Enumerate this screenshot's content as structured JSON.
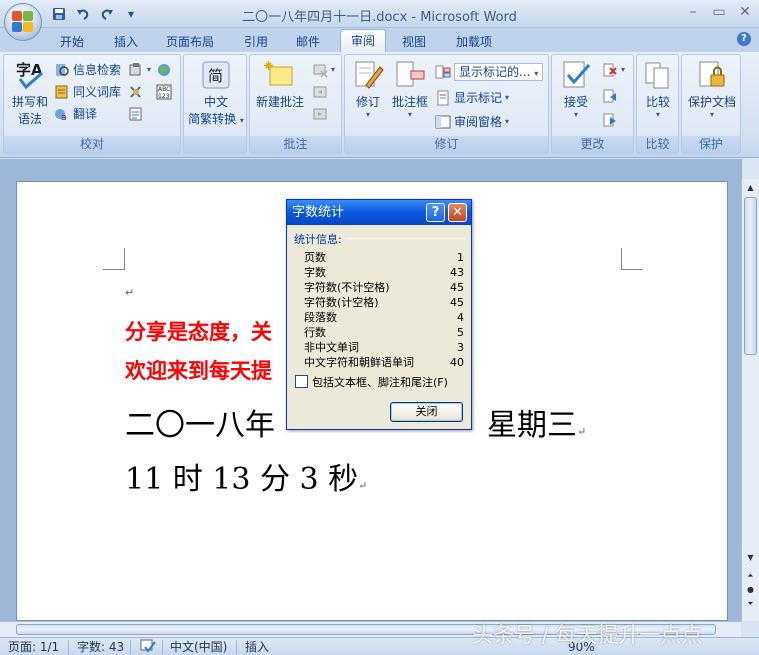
{
  "window": {
    "title": "二〇一八年四月十一日.docx - Microsoft Word",
    "minimize": "–",
    "restore": "▭",
    "close": "✕"
  },
  "qat": {
    "save_icon": "save-icon",
    "undo_icon": "undo-icon",
    "redo_icon": "redo-icon",
    "customize": "▾"
  },
  "tabs": [
    "开始",
    "插入",
    "页面布局",
    "引用",
    "邮件",
    "审阅",
    "视图",
    "加载项"
  ],
  "active_tab": "审阅",
  "help": "?",
  "ribbon": {
    "proofing": {
      "label": "校对",
      "spelling": [
        "拼写和",
        "语法"
      ],
      "research": "信息检索",
      "thesaurus": "同义词库",
      "translate": "翻译"
    },
    "chinese": {
      "icon_char": "简",
      "label_line1": "中文",
      "label_line2": "简繁转换"
    },
    "comments": {
      "label": "批注",
      "new_comment": "新建批注"
    },
    "tracking": {
      "label": "修订",
      "track_changes": "修订",
      "balloons": "批注框",
      "display_dropdown": "显示标记的...",
      "show_markup": "显示标记",
      "reviewing_pane": "审阅窗格"
    },
    "changes": {
      "label": "更改",
      "accept": "接受"
    },
    "compare": {
      "label": "比较"
    },
    "protect": {
      "label": "保护",
      "protect_document": "保护文档"
    }
  },
  "document": {
    "pilcrow": "↵",
    "line1": "分享是态度，关",
    "line2": "欢迎来到每天提",
    "line3": "二〇一八年",
    "line3_tail": "星期三",
    "line4": "11 时 13 分 3 秒"
  },
  "dialog": {
    "title": "字数统计",
    "section": "统计信息:",
    "stats": [
      {
        "label": "页数",
        "value": "1"
      },
      {
        "label": "字数",
        "value": "43"
      },
      {
        "label": "字符数(不计空格)",
        "value": "45"
      },
      {
        "label": "字符数(计空格)",
        "value": "45"
      },
      {
        "label": "段落数",
        "value": "4"
      },
      {
        "label": "行数",
        "value": "5"
      },
      {
        "label": "非中文单词",
        "value": "3"
      },
      {
        "label": "中文字符和朝鲜语单词",
        "value": "40"
      }
    ],
    "checkbox_label": "包括文本框、脚注和尾注(F)",
    "close_button": "关闭"
  },
  "statusbar": {
    "page": "页面: 1/1",
    "words": "字数: 43",
    "language": "中文(中国)",
    "mode": "插入",
    "zoom": "90%"
  },
  "watermark": "头条号 / 每天提升一点点",
  "colors": {
    "accent": "#15428b",
    "red_text": "#ff0000",
    "dialog_title": "#0a58e0"
  }
}
